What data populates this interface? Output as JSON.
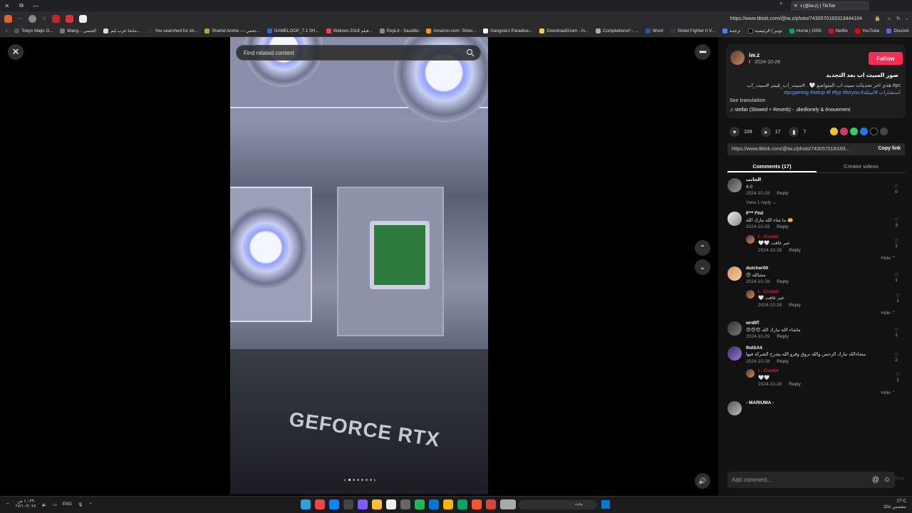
{
  "browser": {
    "tab_title": "ŧ (@iw.z) | TikTok",
    "url": "https://www.tiktok.com/@iw.z/photo/7430570183313444104"
  },
  "bookmarks": [
    "Tokyo Majin G...",
    "Mang... الجسي",
    "مانجا عرب ليم...",
    "You searched for str...",
    "Shahid Anime — تحمي...",
    "GAMELOOP_7.1 SH...",
    "Widows 2018 فيلم...",
    "RepLit - Saudibc",
    "Amazon.com: Silver...",
    "Gangsta's Paradise...",
    "DownloadGram - In...",
    "Compilations!! - ...",
    "Word",
    "Street Fighter II V...",
    "ترجمة",
    "توتير | الرئيسية",
    "Home | OSN",
    "Netflix",
    "YouTube",
    "Discord"
  ],
  "viewer": {
    "search_placeholder": "Find related content",
    "gpu_label": "GEFORCE RTX"
  },
  "post": {
    "username": "iw.z",
    "date": "ŧ · 2024-10-28",
    "follow_label": "Follow",
    "title": "صور السيت اب بعد التجديد",
    "desc_text": "هذي اخر تحديثات سيت اب المتواضع 🤍 . #سيت_اب_قيمر #سيت_اب #pc",
    "desc_tags": "#pcgaming #setup #f #fyp #foryou #استشارات #اسئلة",
    "see_translation": "See translation",
    "music": "stellar (Slowed + Reverb) - .diedlonely & énouement",
    "likes": "109",
    "comments_count": "17",
    "saves": "7",
    "link": "https://www.tiktok.com/@iw.z/photo/74305701833l3...",
    "copy_link": "Copy link",
    "tab_comments": "Comments (17)",
    "tab_creator": "Creator videos"
  },
  "comments": [
    {
      "name": "الجانب",
      "text": "4-0",
      "date": "2024-10-28",
      "reply": "Reply",
      "likes": "0",
      "view_replies": "View 1 reply ⌄"
    },
    {
      "name": "ℓ²³⁰ Fhd",
      "text": "ما شاء الله تبارك الله 🤲",
      "date": "2024-10-28",
      "reply": "Reply",
      "likes": "3",
      "sub": {
        "name": "ŧ · Creator",
        "text": "🤍🤍 خير عافت",
        "date": "2024-10-28",
        "reply": "Reply",
        "likes": "1"
      },
      "hide": "Hide ⌃"
    },
    {
      "name": "dutcher00",
      "text": "😍 مشالله",
      "date": "2024-10-28",
      "reply": "Reply",
      "likes": "1",
      "sub": {
        "name": "ŧ · Creator",
        "text": "🤍 خير عافت",
        "date": "2024-10-28",
        "reply": "Reply",
        "likes": "1"
      },
      "hide": "Hide ⌃"
    },
    {
      "name": "wrd9؟",
      "text": "😍😍😍 ماشاء الله تبارك الله",
      "date": "2024-10-29",
      "reply": "Reply",
      "likes": "1"
    },
    {
      "name": "fhdSA4",
      "text": "مشاءالله تبارك الرحمن والله تروق وقرو الله يشرح الشركة فيها",
      "date": "2024-10-28",
      "reply": "Reply",
      "likes": "2",
      "sub": {
        "name": "ŧ · Creator",
        "text": "🤍🤍",
        "date": "2024-10-28",
        "reply": "Reply",
        "likes": "1"
      },
      "hide": "Hide ⌃"
    },
    {
      "name": "- MARIUMA -",
      "text": "",
      "date": "",
      "reply": "",
      "likes": ""
    }
  ],
  "add_comment": {
    "placeholder": "Add comment...",
    "post_label": "Post"
  },
  "taskbar": {
    "search_placeholder": "بحث",
    "lang": "ENG",
    "time": "١٠:٣٩ ص",
    "date": "٢٧/١٠/٢٠٢٤",
    "weather_temp": "27°C",
    "weather_text": "مشمس غالبًا"
  },
  "colors": {
    "accent": "#fe2c55",
    "hashtag": "#6ba8ff",
    "panel_bg": "#121212"
  }
}
